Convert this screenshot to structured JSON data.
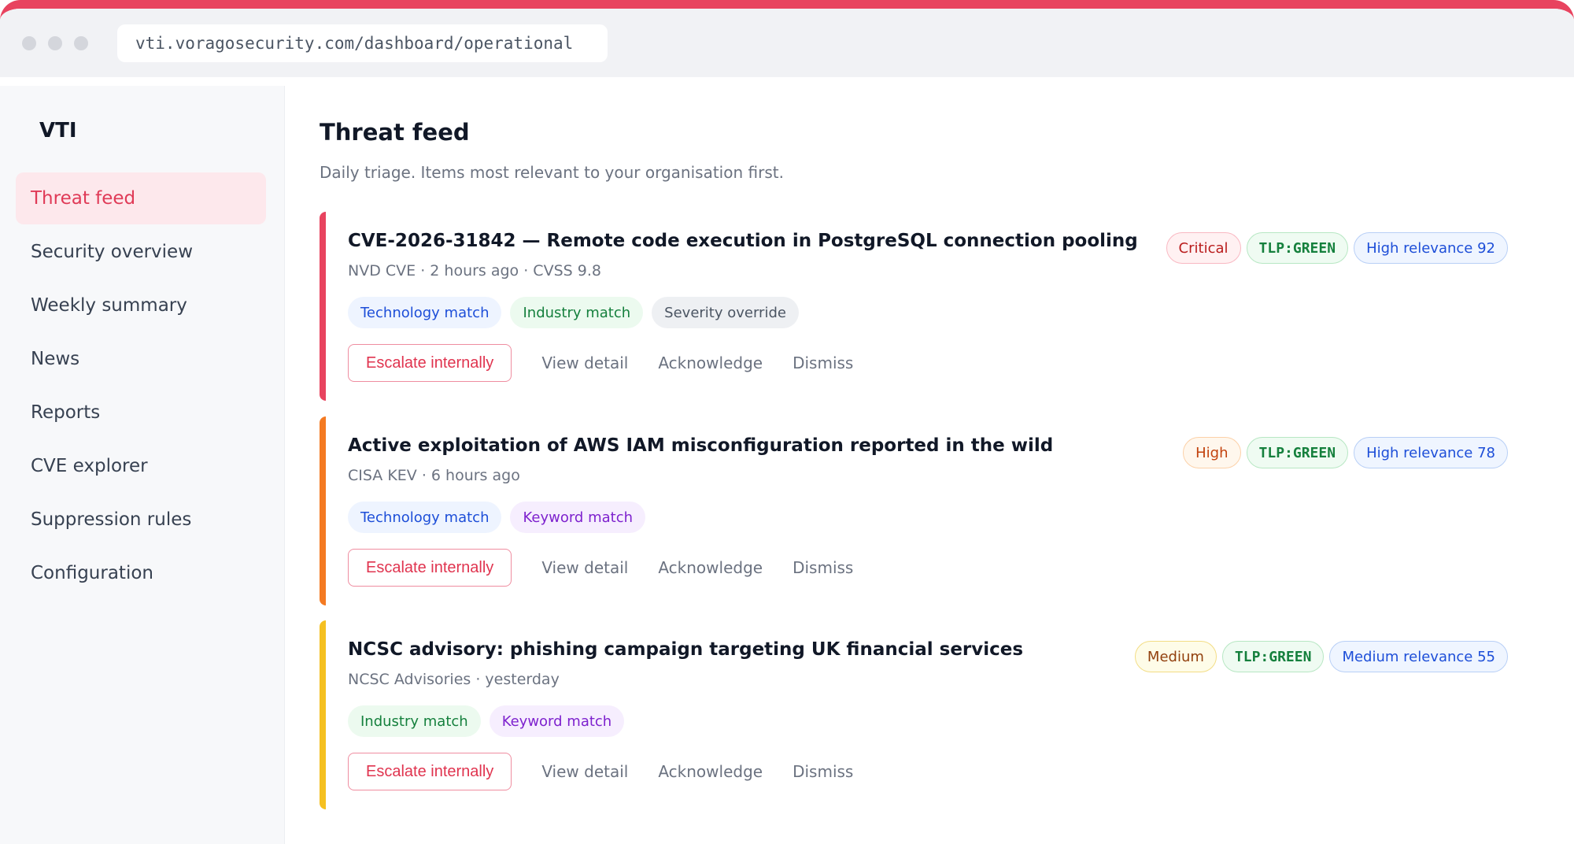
{
  "browser": {
    "url": "vti.voragosecurity.com/dashboard/operational"
  },
  "sidebar": {
    "brand": "VTI",
    "items": [
      {
        "label": "Threat feed"
      },
      {
        "label": "Security overview"
      },
      {
        "label": "Weekly summary"
      },
      {
        "label": "News"
      },
      {
        "label": "Reports"
      },
      {
        "label": "CVE explorer"
      },
      {
        "label": "Suppression rules"
      },
      {
        "label": "Configuration"
      }
    ]
  },
  "main": {
    "title": "Threat feed",
    "subtitle": "Daily triage. Items most relevant to your organisation first.",
    "cards": [
      {
        "accent": "#e8435f",
        "title": "CVE-2026-31842 — Remote code execution in PostgreSQL connection pooling",
        "meta": "NVD CVE · 2 hours ago · CVSS 9.8",
        "severity": "Critical",
        "tlp": "TLP:GREEN",
        "relevance": "High relevance 92",
        "tags": [
          "Technology match",
          "Industry match",
          "Severity override"
        ]
      },
      {
        "accent": "#f47a22",
        "title": "Active exploitation of AWS IAM misconfiguration reported in the wild",
        "meta": "CISA KEV · 6 hours ago",
        "severity": "High",
        "tlp": "TLP:GREEN",
        "relevance": "High relevance 78",
        "tags": [
          "Technology match",
          "Keyword match"
        ]
      },
      {
        "accent": "#f5c021",
        "title": "NCSC advisory: phishing campaign targeting UK financial services",
        "meta": "NCSC Advisories · yesterday",
        "severity": "Medium",
        "tlp": "TLP:GREEN",
        "relevance": "Medium relevance 55",
        "tags": [
          "Industry match",
          "Keyword match"
        ]
      }
    ],
    "actions": {
      "escalate": "Escalate internally",
      "view": "View detail",
      "acknowledge": "Acknowledge",
      "dismiss": "Dismiss"
    }
  }
}
